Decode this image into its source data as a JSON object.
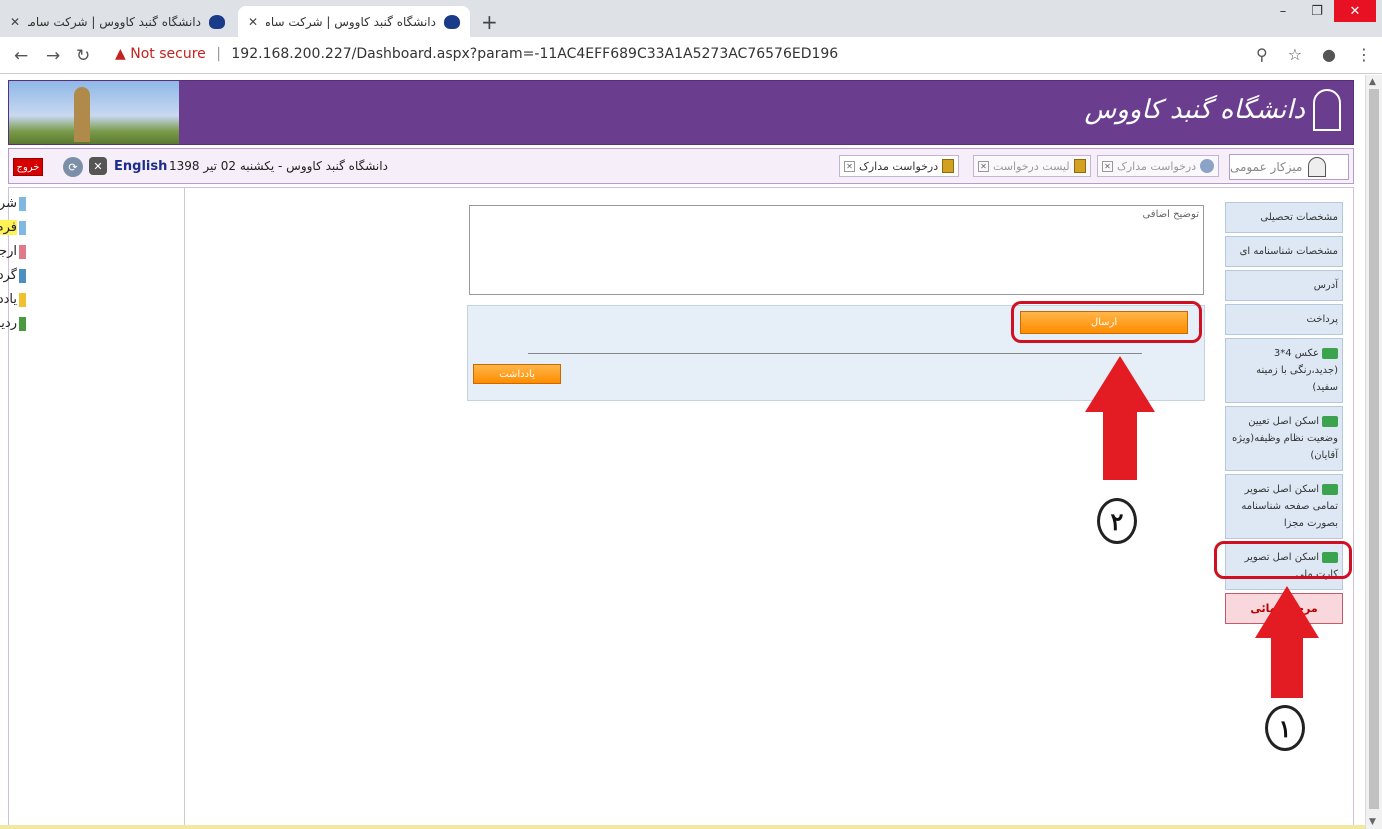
{
  "browser": {
    "tabs": [
      {
        "title": "دانشگاه گنبد کاووس | شرکت سامان",
        "active": false
      },
      {
        "title": "دانشگاه گنبد کاووس | شرکت سامان",
        "active": true
      }
    ],
    "new_tab": "+",
    "url_warning": "Not secure",
    "url": "192.168.200.227/Dashboard.aspx?param=-11AC4EFF689C33A1A5273AC76576ED196"
  },
  "header": {
    "logo_text": "دانشگاه گنبد کاووس"
  },
  "toolbar": {
    "exit_label": "خروج",
    "english_label": "English",
    "date_text": "دانشگاه گنبد کاووس - یکشنبه 02 تیر 1398",
    "tabs": [
      {
        "label": "درخواست مدارک",
        "active": true
      },
      {
        "label": "لیست درخواست",
        "active": false
      },
      {
        "label": "درخواست مدارک",
        "active": false
      }
    ],
    "home_label": "میزکار عمومی"
  },
  "left_panel": {
    "items": [
      {
        "label": "شرح نامه",
        "highlight": false
      },
      {
        "label": "فرم الصاقي",
        "highlight": true
      },
      {
        "label": "ارجاع ها",
        "highlight": false
      },
      {
        "label": "گردش کار",
        "highlight": false
      },
      {
        "label": "یادداشت",
        "highlight": false
      },
      {
        "label": "ردیابی",
        "highlight": false
      }
    ]
  },
  "right_menu": {
    "items": [
      {
        "label": "مشخصات تحصیلی",
        "printer": false
      },
      {
        "label": "مشخصات شناسنامه ای",
        "printer": false
      },
      {
        "label": "آدرس",
        "printer": false
      },
      {
        "label": "پرداخت",
        "printer": false
      },
      {
        "label": "عکس 4*3 (جدید،رنگی با زمینه سفید)",
        "printer": true
      },
      {
        "label": "اسکن اصل تعیین وضعیت نظام وظیفه(ویژه آقایان)",
        "printer": true
      },
      {
        "label": "اسکن اصل تصویر تمامی صفحه شناسنامه بصورت مجزا",
        "printer": true
      },
      {
        "label": "اسکن اصل تصویر کارت ملی",
        "printer": true
      }
    ],
    "final_step": "مرحله نهائی"
  },
  "form": {
    "textarea_placeholder": "توضیح اضافی",
    "send_label": "ارسال",
    "note_label": "یادداشت"
  },
  "annotations": {
    "step1": "۱",
    "step2": "۲",
    "color": "#d01020"
  }
}
